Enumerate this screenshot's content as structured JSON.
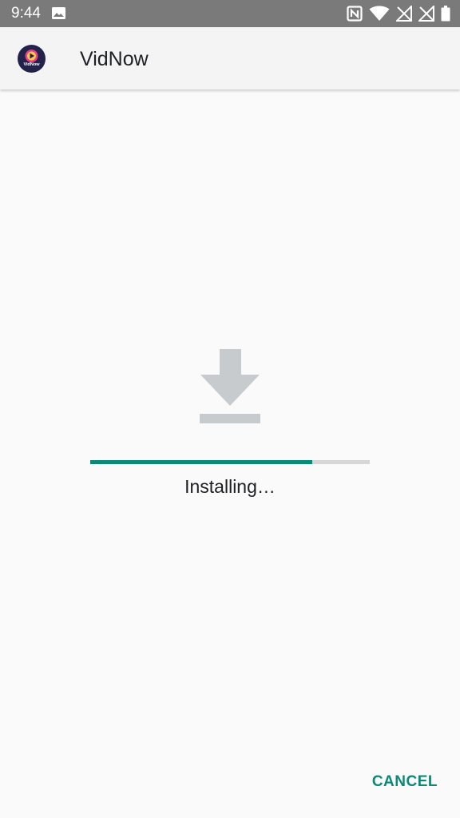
{
  "status_bar": {
    "time": "9:44",
    "icons": [
      "gallery-icon",
      "nfc-icon",
      "wifi-icon",
      "signal-off-icon",
      "signal-off-icon",
      "battery-icon"
    ]
  },
  "app_bar": {
    "title": "VidNow",
    "logo_text": "VidNow"
  },
  "main": {
    "icon": "download-icon",
    "status_text": "Installing…",
    "progress": 0.795
  },
  "actions": {
    "cancel_label": "CANCEL"
  },
  "colors": {
    "accent": "#0a8a76",
    "status_bar": "#7a7a7a",
    "progress_track": "#d6d6d6",
    "icon_gray": "#c8cbce",
    "logo_bg": "#24224a"
  }
}
